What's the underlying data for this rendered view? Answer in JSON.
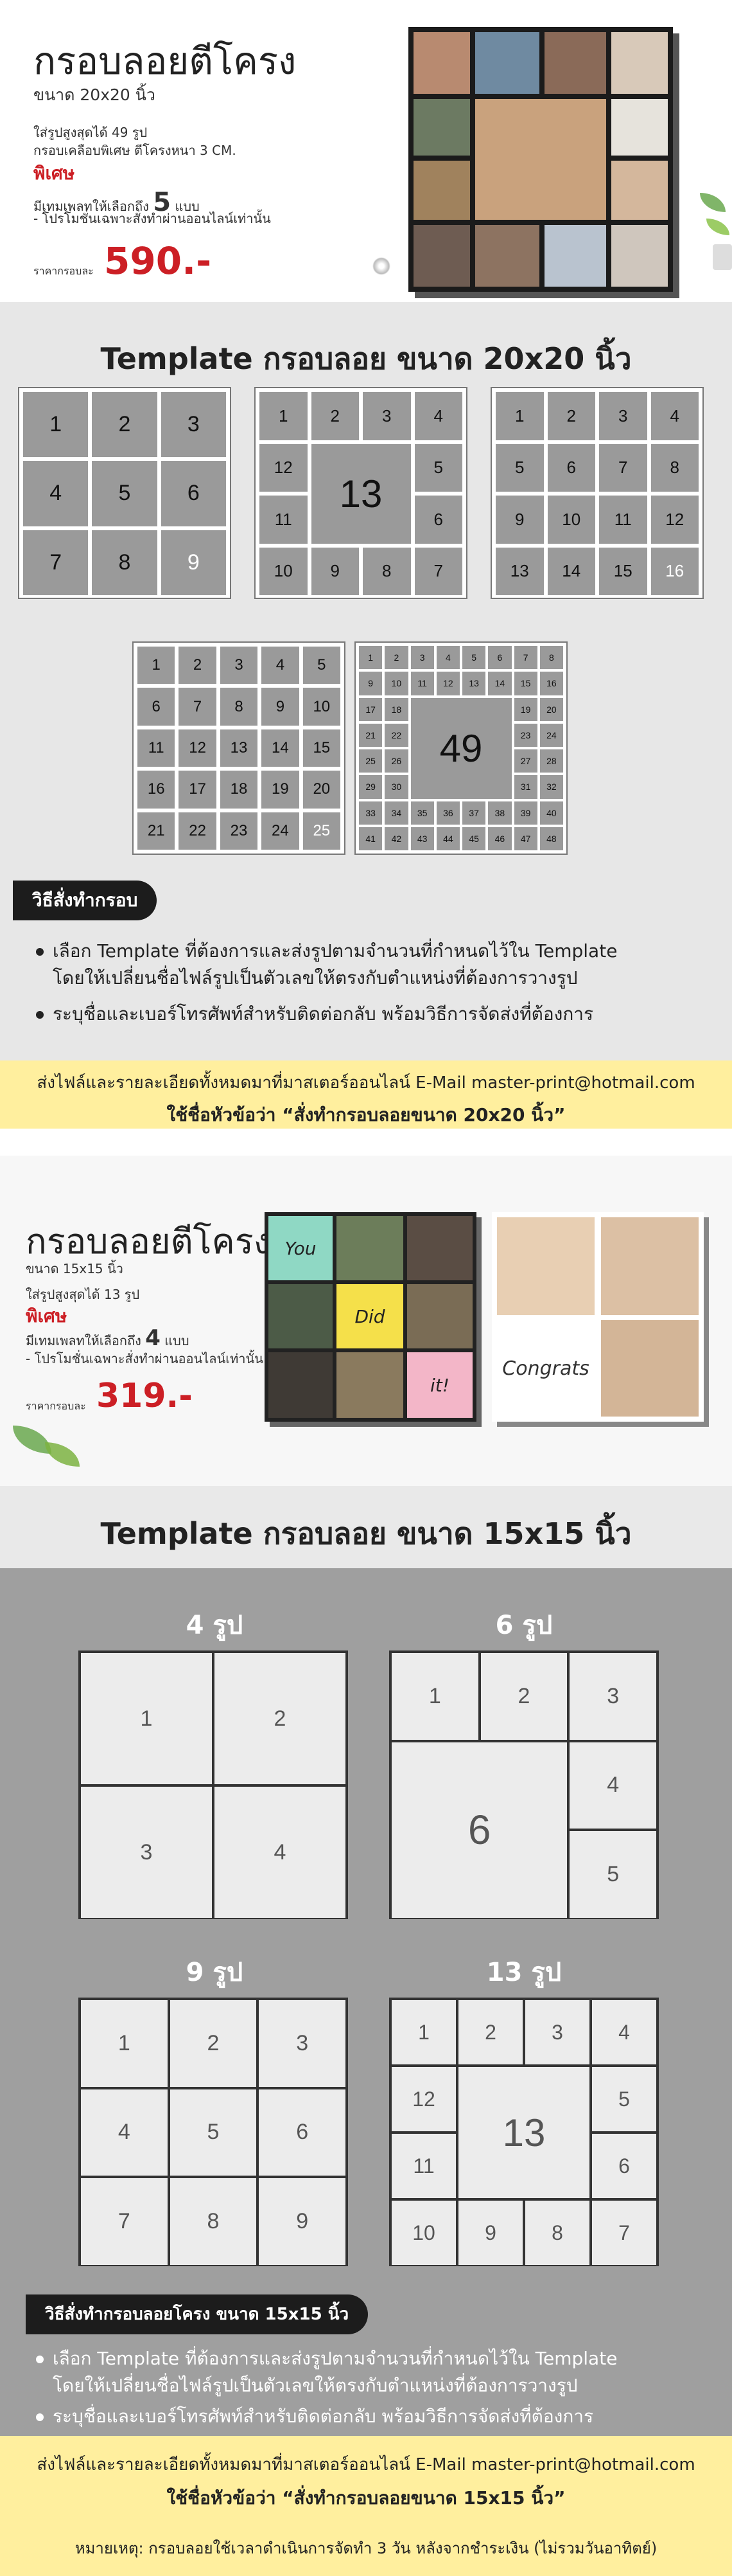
{
  "section1": {
    "title": "กรอบลอยตีโครง",
    "size": "ขนาด 20x20 นิ้ว",
    "capacity": "ใส่รูปสูงสุดได้ 49 รูป",
    "frame_note": "กรอบเคลือบพิเศษ ตีโครงหนา 3 CM.",
    "special_label": "พิเศษ",
    "template_prefix": "มีเทมเพลทให้เลือกถึง",
    "template_count": "5",
    "template_suffix": "แบบ",
    "promo_note": "- โปรโมชั่นเฉพาะสั่งทำผ่านออนไลน์เท่านั้น",
    "price_label": "ราคากรอบละ",
    "price": "590.-",
    "template_title": "Template กรอบลอย ขนาด 20x20 นิ้ว",
    "templates": {
      "t9": [
        "1",
        "2",
        "3",
        "4",
        "5",
        "6",
        "7",
        "8",
        "9"
      ],
      "t13_outer": [
        "1",
        "2",
        "3",
        "4",
        "12",
        "5",
        "11",
        "6",
        "10",
        "9",
        "8",
        "7"
      ],
      "t13_center": "13",
      "t16": [
        "1",
        "2",
        "3",
        "4",
        "5",
        "6",
        "7",
        "8",
        "9",
        "10",
        "11",
        "12",
        "13",
        "14",
        "15",
        "16"
      ],
      "t25": [
        "1",
        "2",
        "3",
        "4",
        "5",
        "6",
        "7",
        "8",
        "9",
        "10",
        "11",
        "12",
        "13",
        "14",
        "15",
        "16",
        "17",
        "18",
        "19",
        "20",
        "21",
        "22",
        "23",
        "24",
        "25"
      ],
      "t49_top": [
        "1",
        "2",
        "3",
        "4",
        "5",
        "6",
        "7",
        "8",
        "9",
        "10",
        "11",
        "12",
        "13",
        "14",
        "15",
        "16"
      ],
      "t49_left": [
        "17",
        "21",
        "25",
        "29"
      ],
      "t49_left2": [
        "18",
        "22",
        "26",
        "30"
      ],
      "t49_right": [
        "19",
        "23",
        "27",
        "31"
      ],
      "t49_right2": [
        "20",
        "24",
        "28",
        "32"
      ],
      "t49_bottom": [
        "33",
        "34",
        "35",
        "36",
        "37",
        "38",
        "39",
        "40",
        "41",
        "42",
        "43",
        "44",
        "45",
        "46",
        "47",
        "48"
      ],
      "t49_center": "49"
    },
    "steps_title": "วิธีสั่งทำกรอบ",
    "steps": [
      "เลือก Template ที่ต้องการและส่งรูปตามจำนวนที่กำหนดไว้ใน Template",
      "โดยให้เปลี่ยนชื่อไฟล์รูปเป็นตัวเลขให้ตรงกับตำแหน่งที่ต้องการวางรูป",
      "ระบุชื่อและเบอร์โทรศัพท์สำหรับติดต่อกลับ พร้อมวิธีการจัดส่งที่ต้องการ"
    ],
    "email_line": "ส่งไฟล์และรายละเอียดทั้งหมดมาที่มาสเตอร์ออนไลน์ E-Mail master-print@hotmail.com",
    "subject_line": "ใช้ชื่อหัวข้อว่า “สั่งทำกรอบลอยขนาด 20x20 นิ้ว”"
  },
  "section2": {
    "title": "กรอบลอยตีโครง",
    "size": "ขนาด 15x15 นิ้ว",
    "capacity": "ใส่รูปสูงสุดได้ 13 รูป",
    "special_label": "พิเศษ",
    "template_prefix": "มีเทมเพลทให้เลือกถึง",
    "template_count": "4",
    "template_suffix": "แบบ",
    "promo_note": "- โปรโมชั่นเฉพาะสั่งทำผ่านออนไลน์เท่านั้น",
    "price_label": "ราคากรอบละ",
    "price": "319.-",
    "collage_words": [
      "You",
      "Did",
      "it!"
    ],
    "congrats": "Congrats",
    "template_title": "Template กรอบลอย ขนาด 15x15 นิ้ว",
    "labels": [
      "4 รูป",
      "6 รูป",
      "9 รูป",
      "13 รูป"
    ],
    "t4": [
      "1",
      "2",
      "3",
      "4"
    ],
    "t6": [
      "1",
      "2",
      "3",
      "4",
      "5",
      "6"
    ],
    "t9": [
      "1",
      "2",
      "3",
      "4",
      "5",
      "6",
      "7",
      "8",
      "9"
    ],
    "t13_outer": [
      "1",
      "2",
      "3",
      "4",
      "12",
      "5",
      "11",
      "6",
      "10",
      "9",
      "8",
      "7"
    ],
    "t13_center": "13",
    "steps_title": "วิธีสั่งทำกรอบลอยโครง ขนาด 15x15 นิ้ว",
    "steps": [
      "เลือก Template ที่ต้องการและส่งรูปตามจำนวนที่กำหนดไว้ใน Template",
      "โดยให้เปลี่ยนชื่อไฟล์รูปเป็นตัวเลขให้ตรงกับตำแหน่งที่ต้องการวางรูป",
      "ระบุชื่อและเบอร์โทรศัพท์สำหรับติดต่อกลับ พร้อมวิธีการจัดส่งที่ต้องการ"
    ],
    "email_line": "ส่งไฟล์และรายละเอียดทั้งหมดมาที่มาสเตอร์ออนไลน์ E-Mail master-print@hotmail.com",
    "subject_line": "ใช้ชื่อหัวข้อว่า “สั่งทำกรอบลอยขนาด 15x15 นิ้ว”",
    "note": "หมายเหตุ: กรอบลอยใช้เวลาดำเนินการจัดทำ 3 วัน หลังจากชำระเงิน (ไม่รวมวันอาทิตย์)"
  },
  "colors": {
    "accent_red": "#cc1f25",
    "yellow_band": "#ffef9e",
    "cell_grey": "#9a9a9a",
    "dark_head": "#1c1c1c"
  }
}
